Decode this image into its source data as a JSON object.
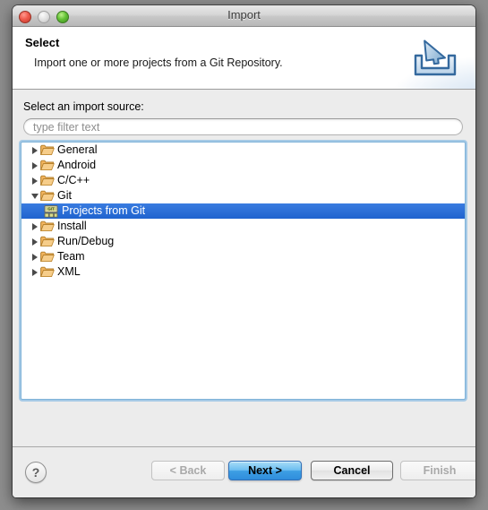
{
  "window": {
    "title": "Import",
    "traffic_lights": [
      "close-light",
      "minimize-light",
      "zoom-light"
    ]
  },
  "header": {
    "title": "Select",
    "description": "Import one or more projects from a Git Repository.",
    "banner_icon": "import-tray-icon"
  },
  "content": {
    "source_label": "Select an import source:",
    "filter": {
      "value": "",
      "placeholder": "type filter text"
    },
    "tree": [
      {
        "label": "General",
        "depth": 0,
        "expanded": false,
        "icon": "folder-icon",
        "selected": false
      },
      {
        "label": "Android",
        "depth": 0,
        "expanded": false,
        "icon": "folder-icon",
        "selected": false
      },
      {
        "label": "C/C++",
        "depth": 0,
        "expanded": false,
        "icon": "folder-icon",
        "selected": false
      },
      {
        "label": "Git",
        "depth": 0,
        "expanded": true,
        "icon": "folder-icon",
        "selected": false
      },
      {
        "label": "Projects from Git",
        "depth": 1,
        "expanded": null,
        "icon": "git-icon",
        "selected": true
      },
      {
        "label": "Install",
        "depth": 0,
        "expanded": false,
        "icon": "folder-icon",
        "selected": false
      },
      {
        "label": "Run/Debug",
        "depth": 0,
        "expanded": false,
        "icon": "folder-icon",
        "selected": false
      },
      {
        "label": "Team",
        "depth": 0,
        "expanded": false,
        "icon": "folder-icon",
        "selected": false
      },
      {
        "label": "XML",
        "depth": 0,
        "expanded": false,
        "icon": "folder-icon",
        "selected": false
      }
    ]
  },
  "footer": {
    "help_label": "?",
    "back_label": "< Back",
    "next_label": "Next >",
    "cancel_label": "Cancel",
    "finish_label": "Finish"
  },
  "colors": {
    "selection_blue": "#2b6cd4",
    "default_button_blue": "#3e9fe4",
    "focus_ring": "#7fb2d8",
    "folder_orange": "#f0b760",
    "window_bg": "#ececec"
  }
}
